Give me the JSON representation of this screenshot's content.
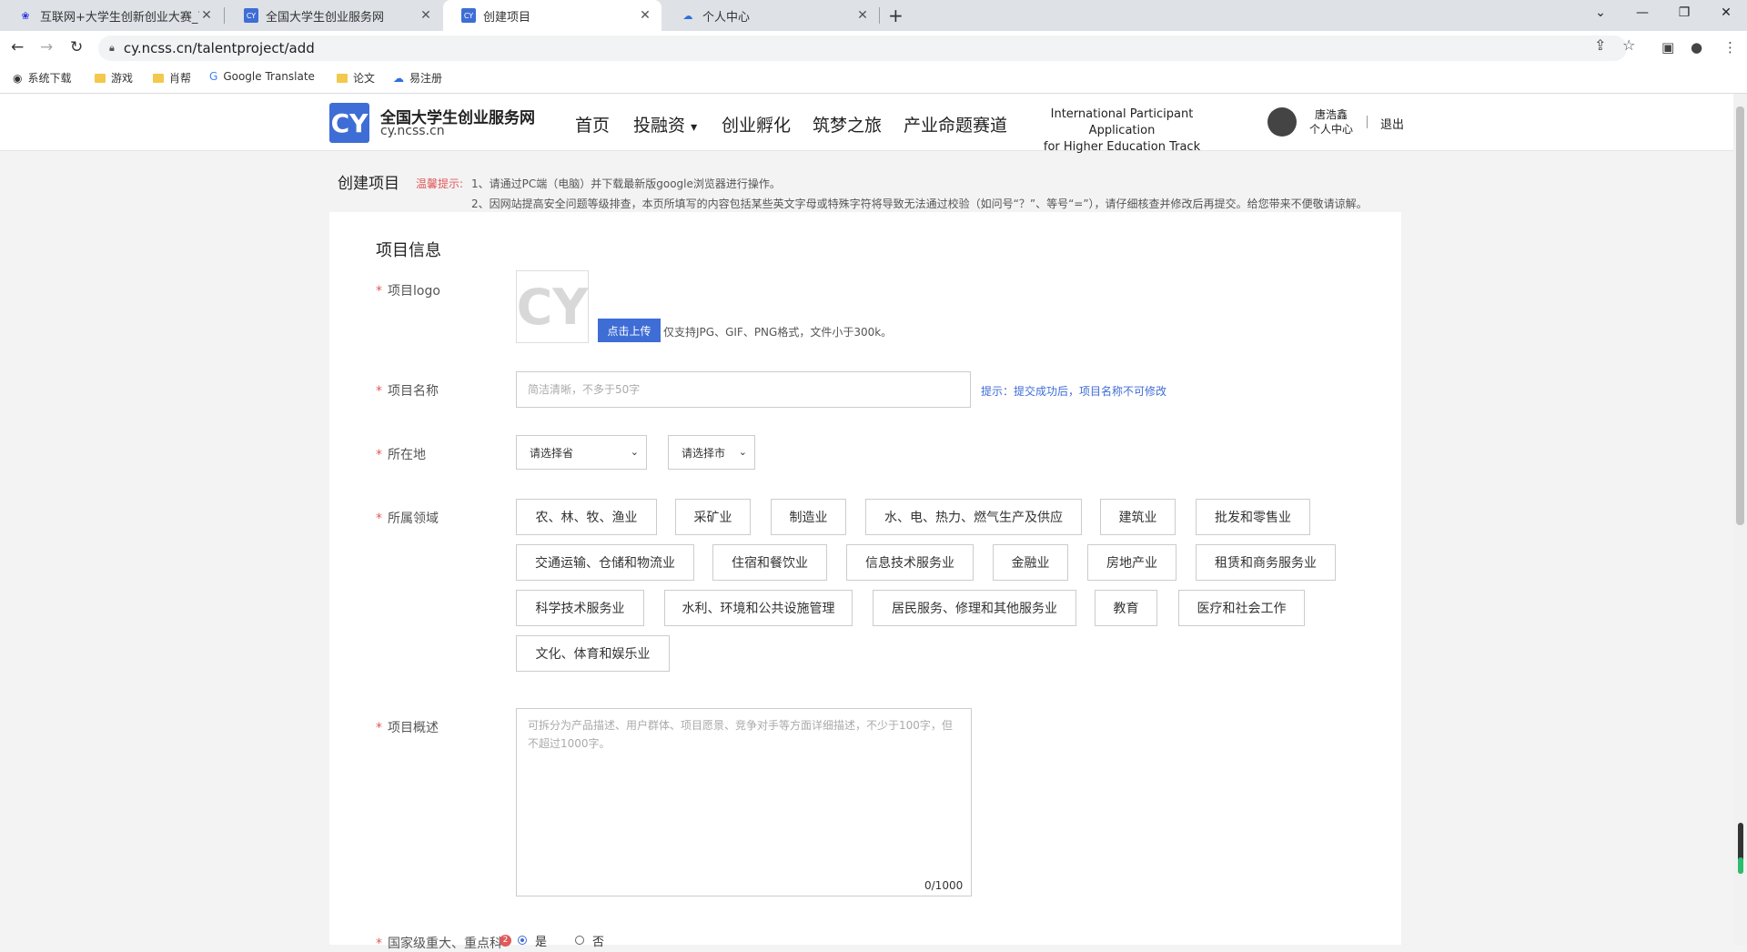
{
  "browser": {
    "tabs": [
      {
        "title": "互联网+大学生创新创业大赛_百度"
      },
      {
        "title": "全国大学生创业服务网"
      },
      {
        "title": "创建项目"
      },
      {
        "title": "个人中心"
      }
    ],
    "new_tab": "+",
    "url": "cy.ncss.cn/talentproject/add",
    "bookmarks": [
      {
        "label": "系统下载"
      },
      {
        "label": "游戏"
      },
      {
        "label": "肖帮"
      },
      {
        "label": "Google Translate"
      },
      {
        "label": "论文"
      },
      {
        "label": "易注册"
      }
    ]
  },
  "site": {
    "logo_glyph": "CY",
    "name": "全国大学生创业服务网",
    "url": "cy.ncss.cn",
    "nav": [
      "首页",
      "投融资",
      "创业孵化",
      "筑梦之旅",
      "产业命题赛道"
    ],
    "nav_dropdown_caret": "▾",
    "intl_line1": "International Participant Application",
    "intl_line2": "for Higher Education Track",
    "user_name": "唐浩鑫",
    "user_center": "个人中心",
    "logout": "退出"
  },
  "page": {
    "title": "创建项目",
    "tip_label": "温馨提示:",
    "tip1": "1、请通过PC端（电脑）并下载最新版google浏览器进行操作。",
    "tip2": "2、因网站提高安全问题等级排查，本页所填写的内容包括某些英文字母或特殊字符将导致无法通过校验（如问号“？”、等号“=”），请仔细核查并修改后再提交。给您带来不便敬请谅解。"
  },
  "form": {
    "section_title": "项目信息",
    "required_mark": "*",
    "logo_label": "项目logo",
    "logo_placeholder": "CY",
    "upload_button": "点击上传",
    "upload_hint": "仅支持JPG、GIF、PNG格式，文件小于300k。",
    "name_label": "项目名称",
    "name_placeholder": "简洁清晰，不多于50字",
    "name_hint": "提示：提交成功后，项目名称不可修改",
    "location_label": "所在地",
    "province_select": "请选择省",
    "city_select": "请选择市",
    "field_label": "所属领域",
    "fields": [
      "农、林、牧、渔业",
      "采矿业",
      "制造业",
      "水、电、热力、燃气生产及供应",
      "建筑业",
      "批发和零售业",
      "交通运输、仓储和物流业",
      "住宿和餐饮业",
      "信息技术服务业",
      "金融业",
      "房地产业",
      "租赁和商务服务业",
      "科学技术服务业",
      "水利、环境和公共设施管理",
      "居民服务、修理和其他服务业",
      "教育",
      "医疗和社会工作",
      "文化、体育和娱乐业"
    ],
    "summary_label": "项目概述",
    "summary_placeholder": "可拆分为产品描述、用户群体、项目愿景、竞争对手等方面详细描述，不少于100字，但不超过1000字。",
    "summary_counter": "0/1000",
    "national_label": "国家级重大、重点科",
    "national_badge": "2",
    "yes": "是",
    "no": "否"
  }
}
